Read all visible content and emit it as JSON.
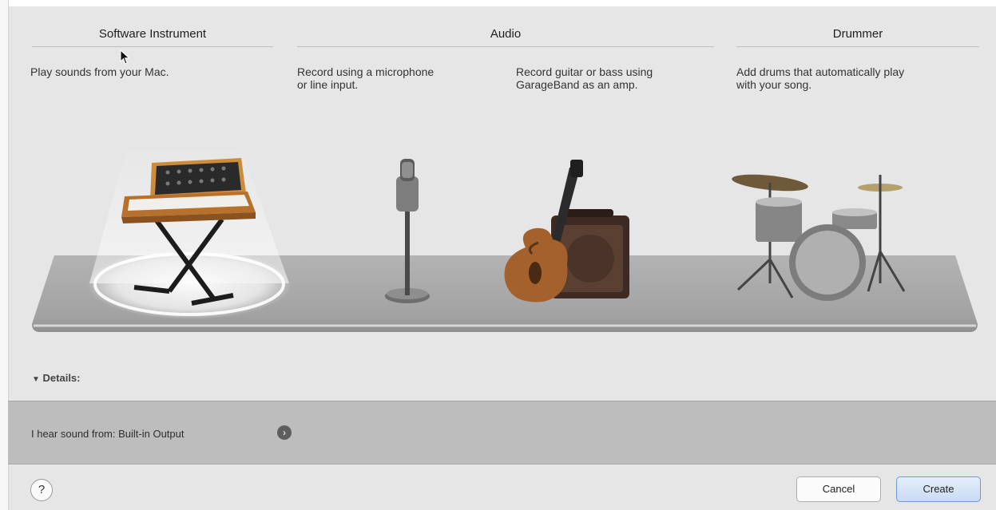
{
  "columns": {
    "software_instrument": {
      "header": "Software Instrument",
      "description": "Play sounds from your Mac."
    },
    "audio": {
      "header": "Audio",
      "microphone_description": "Record using a microphone\nor line input.",
      "guitar_description": "Record guitar or bass using\nGarageBand as an amp."
    },
    "drummer": {
      "header": "Drummer",
      "description": "Add drums that automatically play\nwith your song."
    }
  },
  "selected_track_type": "Software Instrument",
  "details": {
    "label": "Details:",
    "icon": "disclosure-triangle-icon"
  },
  "sound_output": {
    "text": "I hear sound from: Built-in Output",
    "info_icon_glyph": "›"
  },
  "footer": {
    "help_glyph": "?",
    "cancel_label": "Cancel",
    "create_label": "Create"
  },
  "colors": {
    "accent_button_border": "#6f98d6",
    "sound_bar": "#bdbdbd",
    "background": "#e6e6e6"
  }
}
